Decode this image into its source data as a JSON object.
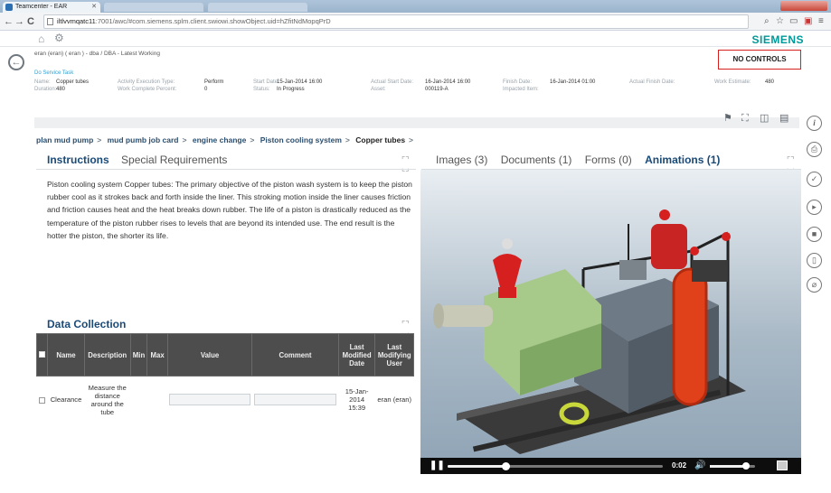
{
  "browser": {
    "tab_title": "Teamcenter - EAR",
    "url_host": "iltlvvmqatc11",
    "url_rest": ":7001/awc/#com.siemens.splm.client.swiowi.showObject.uid=hZfitNdMopqPrD"
  },
  "app": {
    "brand": "SIEMENS"
  },
  "context": {
    "path": "eran (eran) ( eran ) - dba / DBA - Latest Working",
    "no_controls": "NO CONTROLS",
    "task_type": "Do Service Task"
  },
  "properties": {
    "name_label": "Name:",
    "name_value": "Copper tubes",
    "duration_label": "Duration:",
    "duration_value": "480",
    "activity_label": "Activity Execution Type:",
    "activity_value": "Perform",
    "work_pct_label": "Work Complete Percent:",
    "work_pct_value": "0",
    "start_label": "Start Date:",
    "start_value": "15-Jan-2014 16:00",
    "status_label": "Status:",
    "status_value": "In Progress",
    "actual_start_label": "Actual Start Date:",
    "actual_start_value": "16-Jan-2014 16:00",
    "asset_label": "Asset:",
    "asset_value": "000119-A",
    "finish_label": "Finish Date:",
    "finish_value": "16-Jan-2014 01:00",
    "impacted_label": "Impacted Item:",
    "actual_finish_label": "Actual Finish Date:",
    "work_estimate_label": "Work Estimate:",
    "work_estimate_value": "480"
  },
  "breadcrumb": [
    "plan mud pump",
    "mud pumb job card",
    "engine change",
    "Piston cooling system",
    "Copper tubes"
  ],
  "breadcrumb_sep": ">",
  "left_panel": {
    "tabs": [
      "Instructions",
      "Special Requirements"
    ],
    "instructions_text": "Piston cooling system Copper tubes: The primary objective of the piston wash system is to keep the piston rubber cool as it strokes back and forth inside the liner. This stroking motion inside the liner causes friction and friction causes heat and the heat breaks down rubber. The life of a piston is drastically reduced as the temperature of the piston rubber rises to levels that are beyond its intended use. The end result is the hotter the piston, the shorter its life.",
    "data_collection_title": "Data Collection",
    "columns": [
      "Name",
      "Description",
      "Min",
      "Max",
      "Value",
      "Comment",
      "Last Modified Date",
      "Last Modifying User"
    ],
    "rows": [
      {
        "name": "Clearance",
        "description": "Measure the distance around the tube",
        "min": "",
        "max": "",
        "value": "",
        "comment": "",
        "date": "15-Jan-2014 15:39",
        "user": "eran (eran)"
      }
    ]
  },
  "right_panel": {
    "tabs": [
      "Images (3)",
      "Documents (1)",
      "Forms (0)",
      "Animations (1)"
    ],
    "active_tab": 3,
    "player": {
      "time": "0:02",
      "progress": 0.27,
      "volume": 0.8
    }
  },
  "colors": {
    "brand": "#009999",
    "accent": "#1a4a78",
    "alert": "#d61f1f"
  },
  "icons": {
    "rail": [
      "info-icon",
      "print-icon",
      "complete-icon",
      "play-icon",
      "stop-icon",
      "attachment-doc-icon",
      "attachment-clip-icon"
    ],
    "toolbar": [
      "flag-icon",
      "fit-icon",
      "panels-icon",
      "folder-icon"
    ]
  }
}
